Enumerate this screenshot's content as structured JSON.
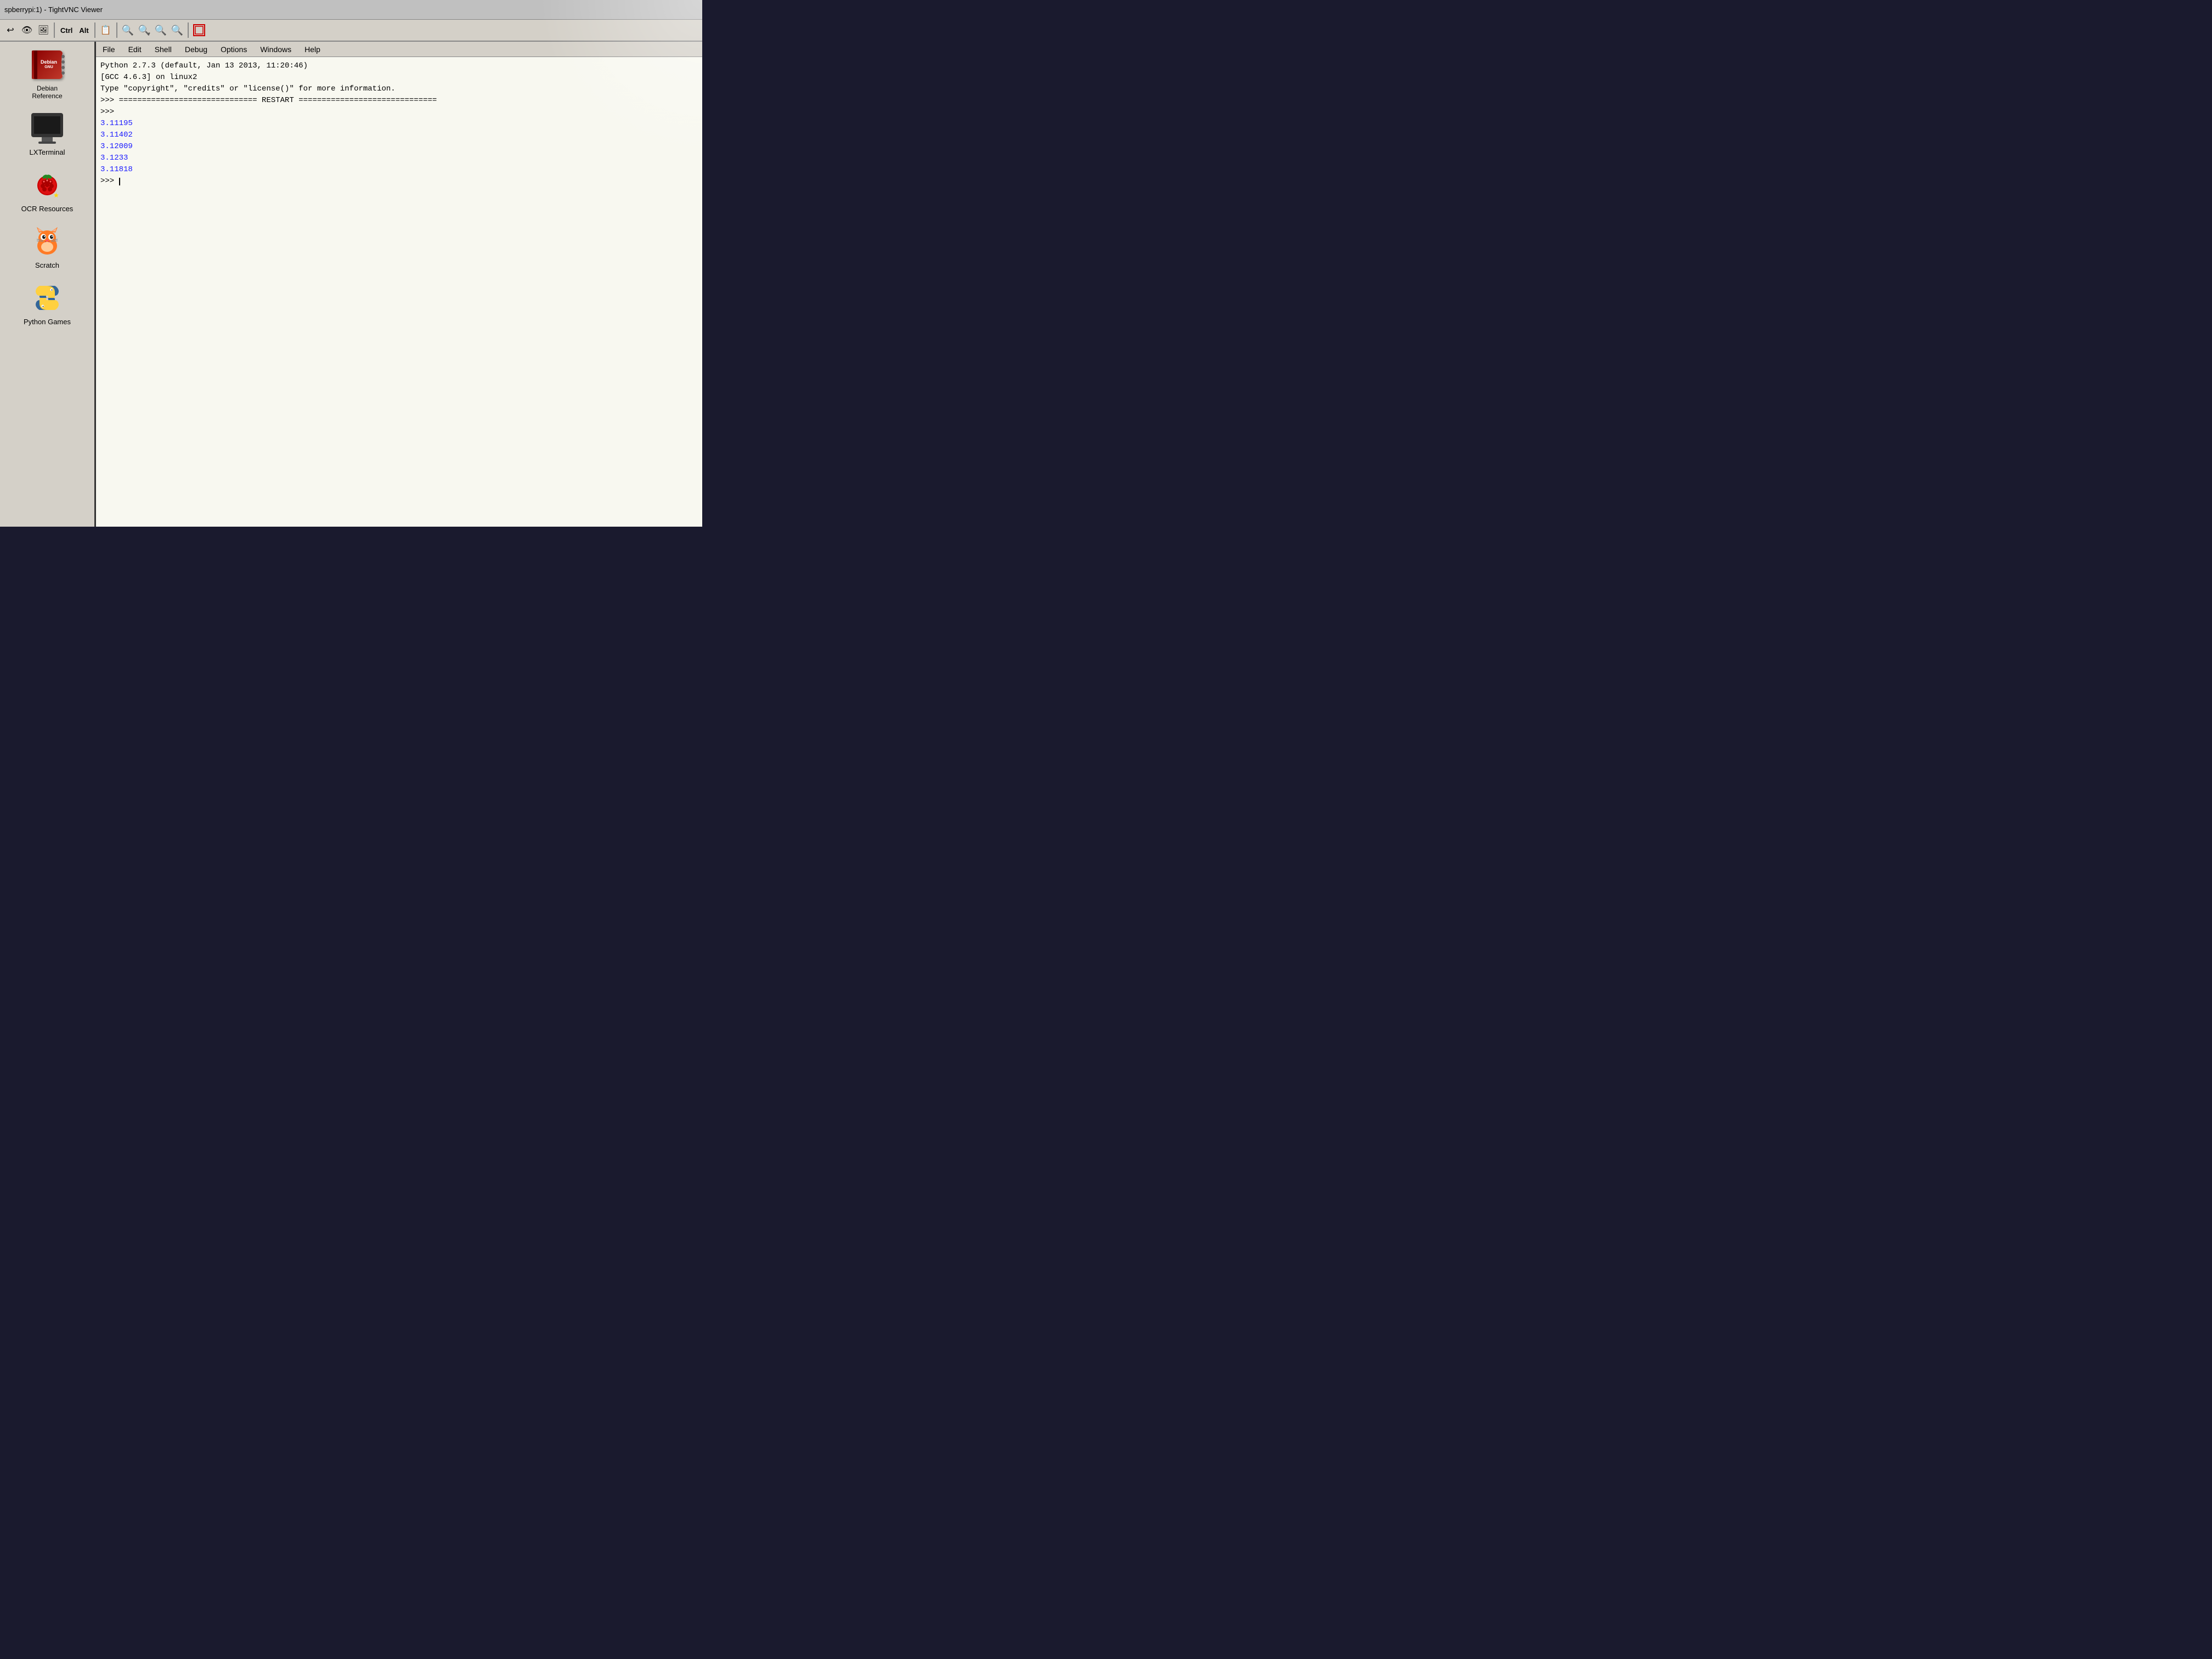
{
  "titlebar": {
    "text": "spberrypi:1) - TightVNC Viewer"
  },
  "toolbar": {
    "buttons": [
      "↩",
      "👁",
      "🖼",
      "Ctrl",
      "Alt",
      "📋",
      "🔍+",
      "🔍-",
      "🔍",
      "🔍",
      "⊞"
    ],
    "ctrl_label": "Ctrl",
    "alt_label": "Alt"
  },
  "sidebar": {
    "items": [
      {
        "id": "debian",
        "label": "Debian\nReference",
        "icon": "book"
      },
      {
        "id": "lxterminal",
        "label": "LXTerminal",
        "icon": "monitor"
      },
      {
        "id": "ocr",
        "label": "OCR Resources",
        "icon": "raspberry"
      },
      {
        "id": "scratch",
        "label": "Scratch",
        "icon": "cat"
      },
      {
        "id": "python-games",
        "label": "Python Games",
        "icon": "python"
      }
    ]
  },
  "shell": {
    "menu": {
      "items": [
        "File",
        "Edit",
        "Shell",
        "Debug",
        "Options",
        "Windows",
        "Help"
      ]
    },
    "lines": [
      {
        "text": "Python 2.7.3 (default, Jan 13 2013, 11:20:46)",
        "color": "black"
      },
      {
        "text": "[GCC 4.6.3] on linux2",
        "color": "black"
      },
      {
        "text": "Type \"copyright\", \"credits\" or \"license()\" for more information.",
        "color": "black"
      },
      {
        "text": ">>> ============================== RESTART ==============================",
        "color": "black"
      },
      {
        "text": ">>>",
        "color": "black"
      },
      {
        "text": "3.11195",
        "color": "blue"
      },
      {
        "text": "3.11402",
        "color": "blue"
      },
      {
        "text": "3.12009",
        "color": "blue"
      },
      {
        "text": "3.1233",
        "color": "blue"
      },
      {
        "text": "3.11818",
        "color": "blue"
      },
      {
        "text": ">>> ",
        "color": "black",
        "cursor": true
      }
    ]
  }
}
